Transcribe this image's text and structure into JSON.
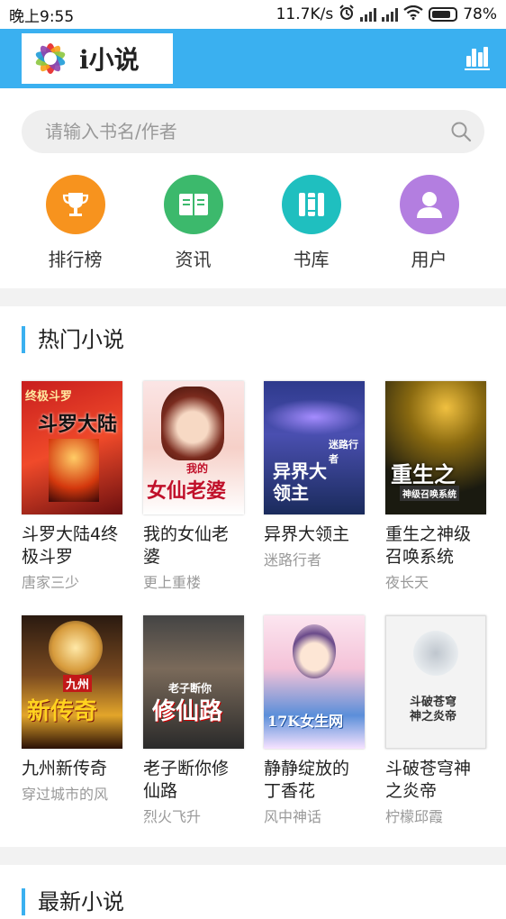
{
  "status": {
    "time": "晚上9:55",
    "speed": "11.7K/s",
    "battery": "78%"
  },
  "app": {
    "logo_text": "i小说",
    "chart_icon": "bar-chart-icon"
  },
  "search": {
    "placeholder": "请输入书名/作者",
    "icon": "search-icon"
  },
  "quick_nav": [
    {
      "label": "排行榜",
      "icon": "trophy-icon",
      "color": "#f7931e"
    },
    {
      "label": "资讯",
      "icon": "news-book-icon",
      "color": "#3cb96c"
    },
    {
      "label": "书库",
      "icon": "library-icon",
      "color": "#1fbfbf"
    },
    {
      "label": "用户",
      "icon": "user-icon",
      "color": "#b37ee0"
    }
  ],
  "hot": {
    "title": "热门小说",
    "books": [
      {
        "title": "斗罗大陆4终极斗罗",
        "author": "唐家三少",
        "cover_text": "斗罗大陆",
        "cover_sub": "终极斗罗"
      },
      {
        "title": "我的女仙老婆",
        "author": "更上重楼",
        "cover_text": "女仙老婆",
        "cover_sub": "我的"
      },
      {
        "title": "异界大领主",
        "author": "迷路行者",
        "cover_text": "异界大领主",
        "cover_sub": "迷路行者"
      },
      {
        "title": "重生之神级召唤系统",
        "author": "夜长天",
        "cover_text": "重生之",
        "cover_sub": "神级召唤系统"
      },
      {
        "title": "九州新传奇",
        "author": "穿过城市的风",
        "cover_text": "新传奇",
        "cover_sub": "九州"
      },
      {
        "title": "老子断你修仙路",
        "author": "烈火飞升",
        "cover_text": "修仙路",
        "cover_sub": "老子断你"
      },
      {
        "title": "静静绽放的丁香花",
        "author": "风中神话",
        "cover_text": "17K女生网",
        "cover_sub": ""
      },
      {
        "title": "斗破苍穹神之炎帝",
        "author": "柠檬邱霞",
        "cover_text": "斗破苍穹",
        "cover_sub": "神之炎帝"
      }
    ]
  },
  "newest": {
    "title": "最新小说"
  }
}
